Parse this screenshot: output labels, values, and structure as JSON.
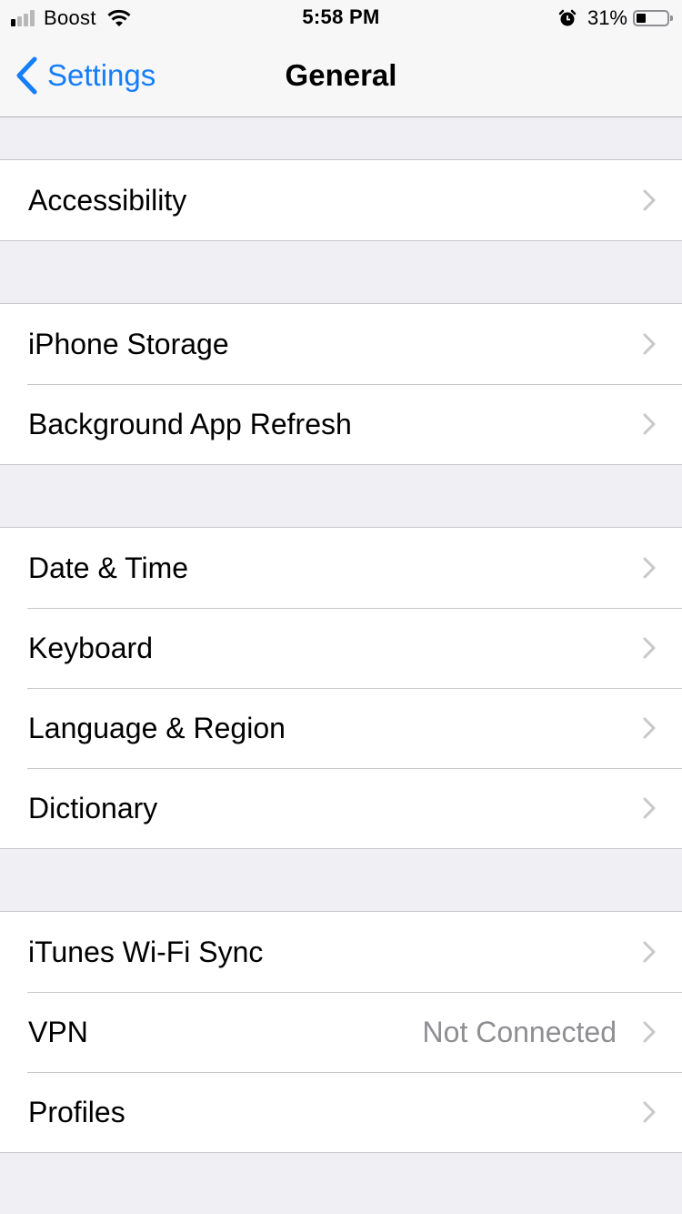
{
  "status_bar": {
    "carrier": "Boost",
    "time": "5:58 PM",
    "battery_percent_label": "31%",
    "battery_level": 0.31,
    "signal_bars_active": 1,
    "signal_bars_total": 4,
    "icons": [
      "signal-icon",
      "wifi-icon",
      "alarm-icon",
      "battery-icon"
    ]
  },
  "nav": {
    "back_label": "Settings",
    "title": "General",
    "accent_color": "#157efb"
  },
  "groups": [
    {
      "rows": [
        {
          "label": "Accessibility",
          "detail": ""
        }
      ]
    },
    {
      "rows": [
        {
          "label": "iPhone Storage",
          "detail": ""
        },
        {
          "label": "Background App Refresh",
          "detail": ""
        }
      ]
    },
    {
      "rows": [
        {
          "label": "Date & Time",
          "detail": ""
        },
        {
          "label": "Keyboard",
          "detail": ""
        },
        {
          "label": "Language & Region",
          "detail": ""
        },
        {
          "label": "Dictionary",
          "detail": ""
        }
      ]
    },
    {
      "rows": [
        {
          "label": "iTunes Wi-Fi Sync",
          "detail": ""
        },
        {
          "label": "VPN",
          "detail": "Not Connected"
        },
        {
          "label": "Profiles",
          "detail": ""
        }
      ]
    }
  ]
}
